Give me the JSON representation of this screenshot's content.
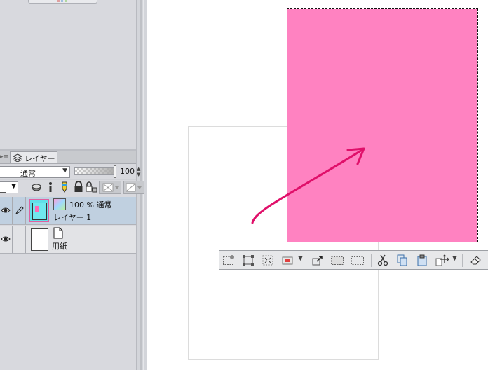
{
  "layer_panel": {
    "tab_label": "レイヤー",
    "blend_mode": "通常",
    "opacity_value": "100",
    "layers": [
      {
        "props": "100 % 通常",
        "name": "レイヤー 1",
        "selected": true
      },
      {
        "name": "用紙",
        "selected": false
      }
    ]
  },
  "canvas": {
    "selection_fill_color": "#ff82c1",
    "arrow_color": "#e0106a"
  },
  "selection_toolbar": {
    "icons": [
      "lasso-select-icon",
      "transform-icon",
      "fit-selection-icon",
      "color-fill-icon",
      "expand-icon",
      "selection-border-icon",
      "deselect-icon",
      "cut-icon",
      "copy-icon",
      "paste-icon",
      "move-icon",
      "eraser-icon"
    ]
  }
}
